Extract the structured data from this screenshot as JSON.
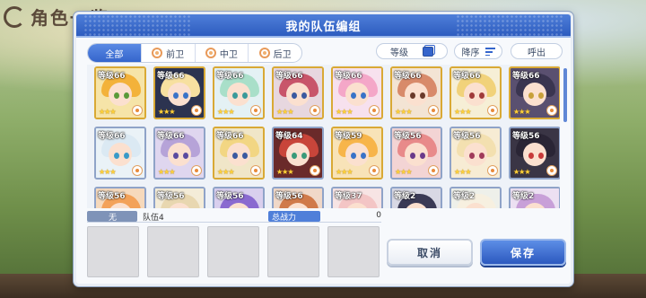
{
  "background": {
    "title": "角色一览"
  },
  "dialog": {
    "title": "我的队伍编组",
    "tabs": [
      {
        "label": "全部",
        "icon": "",
        "active": true
      },
      {
        "label": "前卫",
        "icon": "front-position-icon",
        "active": false
      },
      {
        "label": "中卫",
        "icon": "middle-position-icon",
        "active": false
      },
      {
        "label": "后卫",
        "icon": "back-position-icon",
        "active": false
      }
    ],
    "sort": {
      "level_label": "等级",
      "order_label": "降序",
      "call_label": "呼出"
    },
    "characters": [
      {
        "level": "等级66",
        "stars": "★★★",
        "frame": "gold",
        "hair": "#f3b23a",
        "eye": "#5a9a3a",
        "bg": "#f6e4a8"
      },
      {
        "level": "等级66",
        "stars": "★★★",
        "frame": "gold",
        "hair": "#f7e0a0",
        "eye": "#3a73c8",
        "bg": "#2c3350"
      },
      {
        "level": "等级66",
        "stars": "★★★",
        "frame": "gold",
        "hair": "#a9dfc9",
        "eye": "#3a9a9a",
        "bg": "#e4f1f4"
      },
      {
        "level": "等级66",
        "stars": "★★★",
        "frame": "gold",
        "hair": "#c8556a",
        "eye": "#3a5aa0",
        "bg": "#e7d7df"
      },
      {
        "level": "等级66",
        "stars": "★★★",
        "frame": "gold",
        "hair": "#f4a7c8",
        "eye": "#3a73c8",
        "bg": "#f7e1ee"
      },
      {
        "level": "等级66",
        "stars": "★★★",
        "frame": "gold",
        "hair": "#d88a6a",
        "eye": "#6a3a2a",
        "bg": "#f3e4d4"
      },
      {
        "level": "等级66",
        "stars": "★★★",
        "frame": "gold",
        "hair": "#f1d27a",
        "eye": "#a03a3a",
        "bg": "#f6efd6"
      },
      {
        "level": "等级66",
        "stars": "★★★",
        "frame": "gold",
        "hair": "#3a3550",
        "eye": "#c8a03a",
        "bg": "#5a5070"
      },
      {
        "level": "等级66",
        "stars": "★★★",
        "frame": "silver",
        "hair": "#dbe9f3",
        "eye": "#3a9ac8",
        "bg": "#eaf2f7"
      },
      {
        "level": "等级66",
        "stars": "★★★",
        "frame": "silver",
        "hair": "#b6a3d8",
        "eye": "#5a4aa0",
        "bg": "#dfd6ef"
      },
      {
        "level": "等级66",
        "stars": "★★★",
        "frame": "gold",
        "hair": "#f2d683",
        "eye": "#3a5aa0",
        "bg": "#f0e6c8"
      },
      {
        "level": "等级64",
        "stars": "★★★",
        "frame": "silver",
        "hair": "#c8453a",
        "eye": "#3a9a7a",
        "bg": "#6a2a2a"
      },
      {
        "level": "等级59",
        "stars": "★★★",
        "frame": "gold",
        "hair": "#f7b54a",
        "eye": "#3a73c8",
        "bg": "#f8e3b8"
      },
      {
        "level": "等级56",
        "stars": "★★★",
        "frame": "silver",
        "hair": "#e88a8a",
        "eye": "#6a3a8a",
        "bg": "#f3d4d4"
      },
      {
        "level": "等级56",
        "stars": "★★★",
        "frame": "silver",
        "hair": "#f3e0b0",
        "eye": "#a03a5a",
        "bg": "#f7ecd4"
      },
      {
        "level": "等级56",
        "stars": "★★★",
        "frame": "silver",
        "hair": "#2a2535",
        "eye": "#c83a3a",
        "bg": "#3a3545"
      },
      {
        "level": "等级56",
        "stars": "",
        "frame": "silver",
        "hair": "#f3a25a",
        "eye": "#3a3a3a",
        "bg": "#f6d9bc"
      },
      {
        "level": "等级56",
        "stars": "",
        "frame": "silver",
        "hair": "#e8d7b0",
        "eye": "#3a3a3a",
        "bg": "#f4ecd8"
      },
      {
        "level": "等级56",
        "stars": "",
        "frame": "silver",
        "hair": "#8a6ad0",
        "eye": "#3a3a3a",
        "bg": "#d9cfee"
      },
      {
        "level": "等级56",
        "stars": "",
        "frame": "silver",
        "hair": "#d07a4a",
        "eye": "#3a3a3a",
        "bg": "#f0d8c8"
      },
      {
        "level": "等级37",
        "stars": "",
        "frame": "silver",
        "hair": "#f3c5c5",
        "eye": "#3a3a3a",
        "bg": "#f7e4e4"
      },
      {
        "level": "等级2",
        "stars": "",
        "frame": "silver",
        "hair": "#3a3a55",
        "eye": "#3a3a3a",
        "bg": "#d8d8e4"
      },
      {
        "level": "等级2",
        "stars": "",
        "frame": "silver",
        "hair": "#f7f0e0",
        "eye": "#3a3a3a",
        "bg": "#eef0ea"
      },
      {
        "level": "等级2",
        "stars": "",
        "frame": "silver",
        "hair": "#c8a0d8",
        "eye": "#3a3a3a",
        "bg": "#ece0f2"
      }
    ],
    "team": {
      "attribute_label": "无",
      "name": "队伍4",
      "power_label": "总战力",
      "power_value": "0"
    },
    "buttons": {
      "cancel": "取消",
      "save": "保存"
    }
  }
}
